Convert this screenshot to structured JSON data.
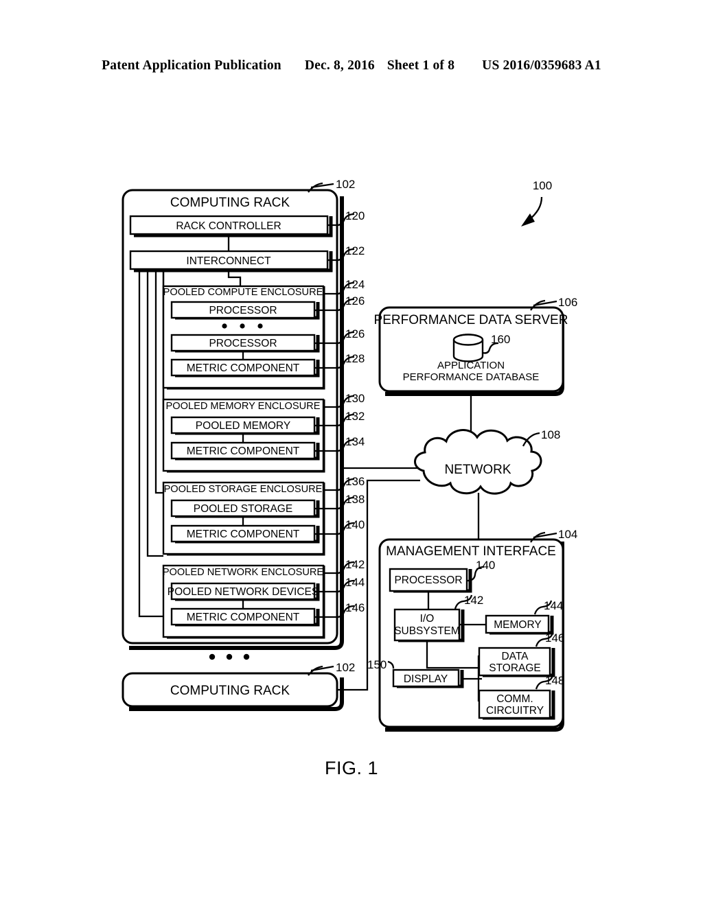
{
  "header": {
    "publication": "Patent Application Publication",
    "date": "Dec. 8, 2016",
    "sheet": "Sheet 1 of 8",
    "patent_number": "US 2016/0359683 A1"
  },
  "figure": {
    "caption": "FIG. 1",
    "system_ref": "100"
  },
  "rack": {
    "title": "COMPUTING RACK",
    "ref": "102",
    "controller": {
      "label": "RACK CONTROLLER",
      "ref": "120"
    },
    "interconnect": {
      "label": "INTERCONNECT",
      "ref": "122"
    },
    "ellipsis": "• • •",
    "enclosures": [
      {
        "title": "POOLED COMPUTE ENCLOSURE",
        "ref": "124",
        "children": [
          {
            "label": "PROCESSOR",
            "ref": "126"
          },
          {
            "label": "PROCESSOR",
            "ref": "126"
          },
          {
            "label": "METRIC COMPONENT",
            "ref": "128"
          }
        ]
      },
      {
        "title": "POOLED MEMORY ENCLOSURE",
        "ref": "130",
        "children": [
          {
            "label": "POOLED MEMORY",
            "ref": "132"
          },
          {
            "label": "METRIC COMPONENT",
            "ref": "134"
          }
        ]
      },
      {
        "title": "POOLED STORAGE ENCLOSURE",
        "ref": "136",
        "children": [
          {
            "label": "POOLED STORAGE",
            "ref": "138"
          },
          {
            "label": "METRIC COMPONENT",
            "ref": "140"
          }
        ]
      },
      {
        "title": "POOLED NETWORK ENCLOSURE",
        "ref": "142",
        "children": [
          {
            "label": "POOLED NETWORK DEVICES",
            "ref": "144"
          },
          {
            "label": "METRIC COMPONENT",
            "ref": "146"
          }
        ]
      }
    ]
  },
  "rack_second": {
    "title": "COMPUTING RACK",
    "ref": "102",
    "ellipsis": "• • •"
  },
  "perf_server": {
    "title": "PERFORMANCE DATA SERVER",
    "ref": "106",
    "database": {
      "icon": "database-cylinder-icon",
      "ref": "160",
      "label_line1": "APPLICATION",
      "label_line2": "PERFORMANCE DATABASE"
    }
  },
  "network": {
    "label": "NETWORK",
    "ref": "108",
    "icon": "cloud-icon"
  },
  "management_interface": {
    "title": "MANAGEMENT INTERFACE",
    "ref": "104",
    "components": [
      {
        "label": "PROCESSOR",
        "ref": "140"
      },
      {
        "label_line1": "I/O",
        "label_line2": "SUBSYSTEM",
        "ref": "142"
      },
      {
        "label": "MEMORY",
        "ref": "144"
      },
      {
        "label_line1": "DATA",
        "label_line2": "STORAGE",
        "ref": "146"
      },
      {
        "label_line1": "COMM.",
        "label_line2": "CIRCUITRY",
        "ref": "148"
      },
      {
        "label": "DISPLAY",
        "ref": "150"
      }
    ]
  },
  "colors": {
    "ink": "#000000",
    "paper": "#ffffff"
  }
}
